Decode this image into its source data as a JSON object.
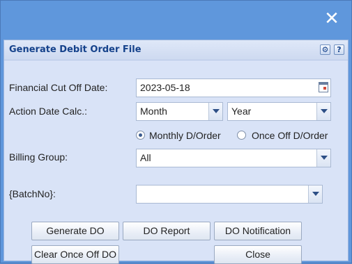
{
  "window": {
    "close_icon": "close-icon"
  },
  "dialog": {
    "title": "Generate Debit Order File",
    "tools": {
      "gear_icon": "gear-icon",
      "help_label": "?"
    }
  },
  "form": {
    "financial_cut_off_date": {
      "label": "Financial Cut Off Date:",
      "value": "2023-05-18",
      "icon": "calendar-icon"
    },
    "action_date_calc": {
      "label": "Action Date Calc.:",
      "period_value": "Month",
      "type_value": "Year"
    },
    "debit_order_type": {
      "options": [
        {
          "label": "Monthly D/Order",
          "checked": true
        },
        {
          "label": "Once Off D/Order",
          "checked": false
        }
      ]
    },
    "billing_group": {
      "label": "Billing Group:",
      "value": "All"
    },
    "batch_no": {
      "label": "{BatchNo}:",
      "value": ""
    }
  },
  "buttons": {
    "generate_do": "Generate DO",
    "do_report": "DO Report",
    "do_notification": "DO Notification",
    "clear_once_off_do": "Clear Once Off DO",
    "close": "Close"
  },
  "colors": {
    "window_bg": "#5f97dc",
    "panel_bg": "#d9e3f7",
    "title_text": "#15428b"
  }
}
